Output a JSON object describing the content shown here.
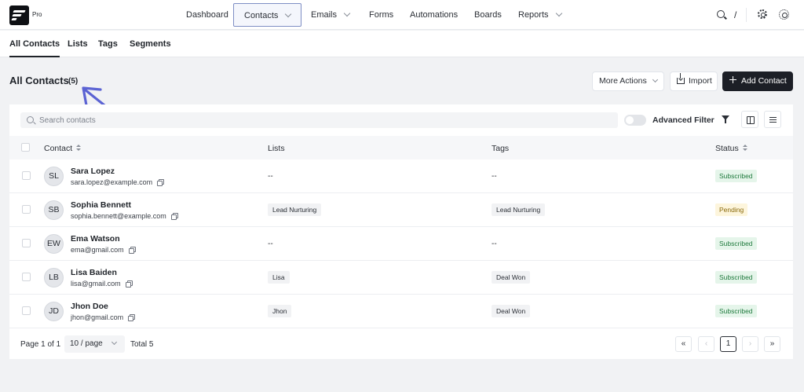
{
  "brand": {
    "badge": "Pro"
  },
  "nav": {
    "items": [
      {
        "label": "Dashboard"
      },
      {
        "label": "Contacts"
      },
      {
        "label": "Emails"
      },
      {
        "label": "Forms"
      },
      {
        "label": "Automations"
      },
      {
        "label": "Boards"
      },
      {
        "label": "Reports"
      }
    ],
    "search_shortcut": "/",
    "icons": [
      "search-icon",
      "gear-icon",
      "sun-icon"
    ]
  },
  "subtabs": [
    "All Contacts",
    "Lists",
    "Tags",
    "Segments"
  ],
  "header": {
    "title": "All Contacts",
    "count": "(5)",
    "more_actions": "More Actions",
    "import": "Import",
    "add_contact": "Add Contact"
  },
  "toolbar": {
    "search_placeholder": "Search contacts",
    "advanced_filter": "Advanced Filter"
  },
  "table": {
    "columns": [
      "Contact",
      "Lists",
      "Tags",
      "Status"
    ],
    "rows": [
      {
        "initials": "SL",
        "name": "Sara Lopez",
        "email": "sara.lopez@example.com",
        "list": "--",
        "tag": "--",
        "status": "Subscribed"
      },
      {
        "initials": "SB",
        "name": "Sophia Bennett",
        "email": "sophia.bennett@example.com",
        "list": "Lead Nurturing",
        "tag": "Lead Nurturing",
        "status": "Pending"
      },
      {
        "initials": "EW",
        "name": "Ema Watson",
        "email": "ema@gmail.com",
        "list": "--",
        "tag": "--",
        "status": "Subscribed"
      },
      {
        "initials": "LB",
        "name": "Lisa Baiden",
        "email": "lisa@gmail.com",
        "list": "Lisa",
        "tag": "Deal Won",
        "status": "Subscribed"
      },
      {
        "initials": "JD",
        "name": "Jhon Doe",
        "email": "jhon@gmail.com",
        "list": "Jhon",
        "tag": "Deal Won",
        "status": "Subscribed"
      }
    ]
  },
  "pagination": {
    "page_info": "Page 1 of 1",
    "per_page": "10 / page",
    "total": "Total 5",
    "first": "«",
    "prev": "‹",
    "current": "1",
    "next": "›",
    "last": "»"
  },
  "colors": {
    "primary": "#1c1f26",
    "active_nav_border": "#7e8ec4",
    "annotation_arrow": "#5b63d3",
    "subscribed_bg": "#e5f5ea",
    "subscribed_text": "#1f7a3d",
    "pending_bg": "#fdf5dc",
    "pending_text": "#8a6a0c"
  }
}
